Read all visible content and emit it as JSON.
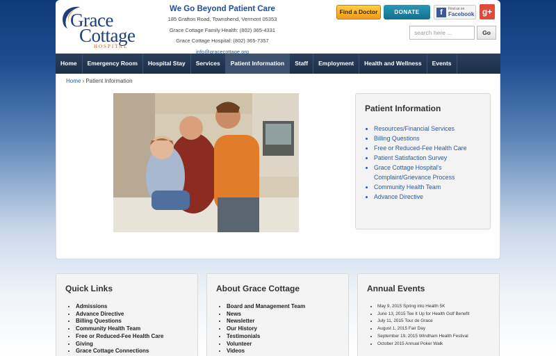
{
  "header": {
    "logo": {
      "line1": "Grace",
      "line2": "Cottage",
      "line3": "HOSPITAL"
    },
    "tagline": "We Go Beyond Patient Care",
    "address": "185 Grafton Road, Townshend, Vermont 05353",
    "family_health": "Grace Cottage Family Health: (802) 365-4331",
    "hospital_phone": "Grace Cottage Hospital: (802) 365-7357",
    "email": "info@gracecottage.org",
    "find_doctor": "Find a Doctor",
    "donate": "DONATE",
    "facebook_small": "Find us on",
    "facebook_big": "Facebook",
    "googleplus": "g+",
    "search_placeholder": "search here ...",
    "search_button": "Go"
  },
  "nav": {
    "items": [
      {
        "label": "Home"
      },
      {
        "label": "Emergency Room"
      },
      {
        "label": "Hospital Stay"
      },
      {
        "label": "Services"
      },
      {
        "label": "Patient Information",
        "active": true
      },
      {
        "label": "Staff"
      },
      {
        "label": "Employment"
      },
      {
        "label": "Health and Wellness"
      },
      {
        "label": "Events"
      }
    ]
  },
  "breadcrumb": {
    "home": "Home",
    "separator": " › ",
    "current": "Patient Information"
  },
  "sidebar": {
    "title": "Patient Information",
    "links": [
      "Resources/Financial Services",
      "Billing Questions",
      "Free or Reduced-Fee Health Care",
      "Patient Satisfaction Survey",
      "Grace Cottage Hospital's Complaint/Grievance Process",
      "Community Health Team",
      "Advance Directive"
    ]
  },
  "quick_links": {
    "title": "Quick Links",
    "items": [
      "Admissions",
      "Advance Directive",
      "Billing Questions",
      "Community Health Team",
      "Free or Reduced-Fee Health Care",
      "Giving",
      "Grace Cottage Connections"
    ]
  },
  "about": {
    "title": "About Grace Cottage",
    "items": [
      "Board and Management Team",
      "News",
      "Newsletter",
      "Our History",
      "Testimonials",
      "Volunteer",
      "Videos"
    ]
  },
  "annual_events": {
    "title": "Annual Events",
    "items": [
      "May 9, 2015 Spring into Health 5K",
      "June 13, 2015 Tee It Up for Health Golf Benefit",
      "July 11, 2015 Tour de Grace",
      "August 1, 2015 Fair Day",
      "September 19, 2015 Windham Health Festival",
      "October 2015 Annual Poker Walk"
    ]
  }
}
